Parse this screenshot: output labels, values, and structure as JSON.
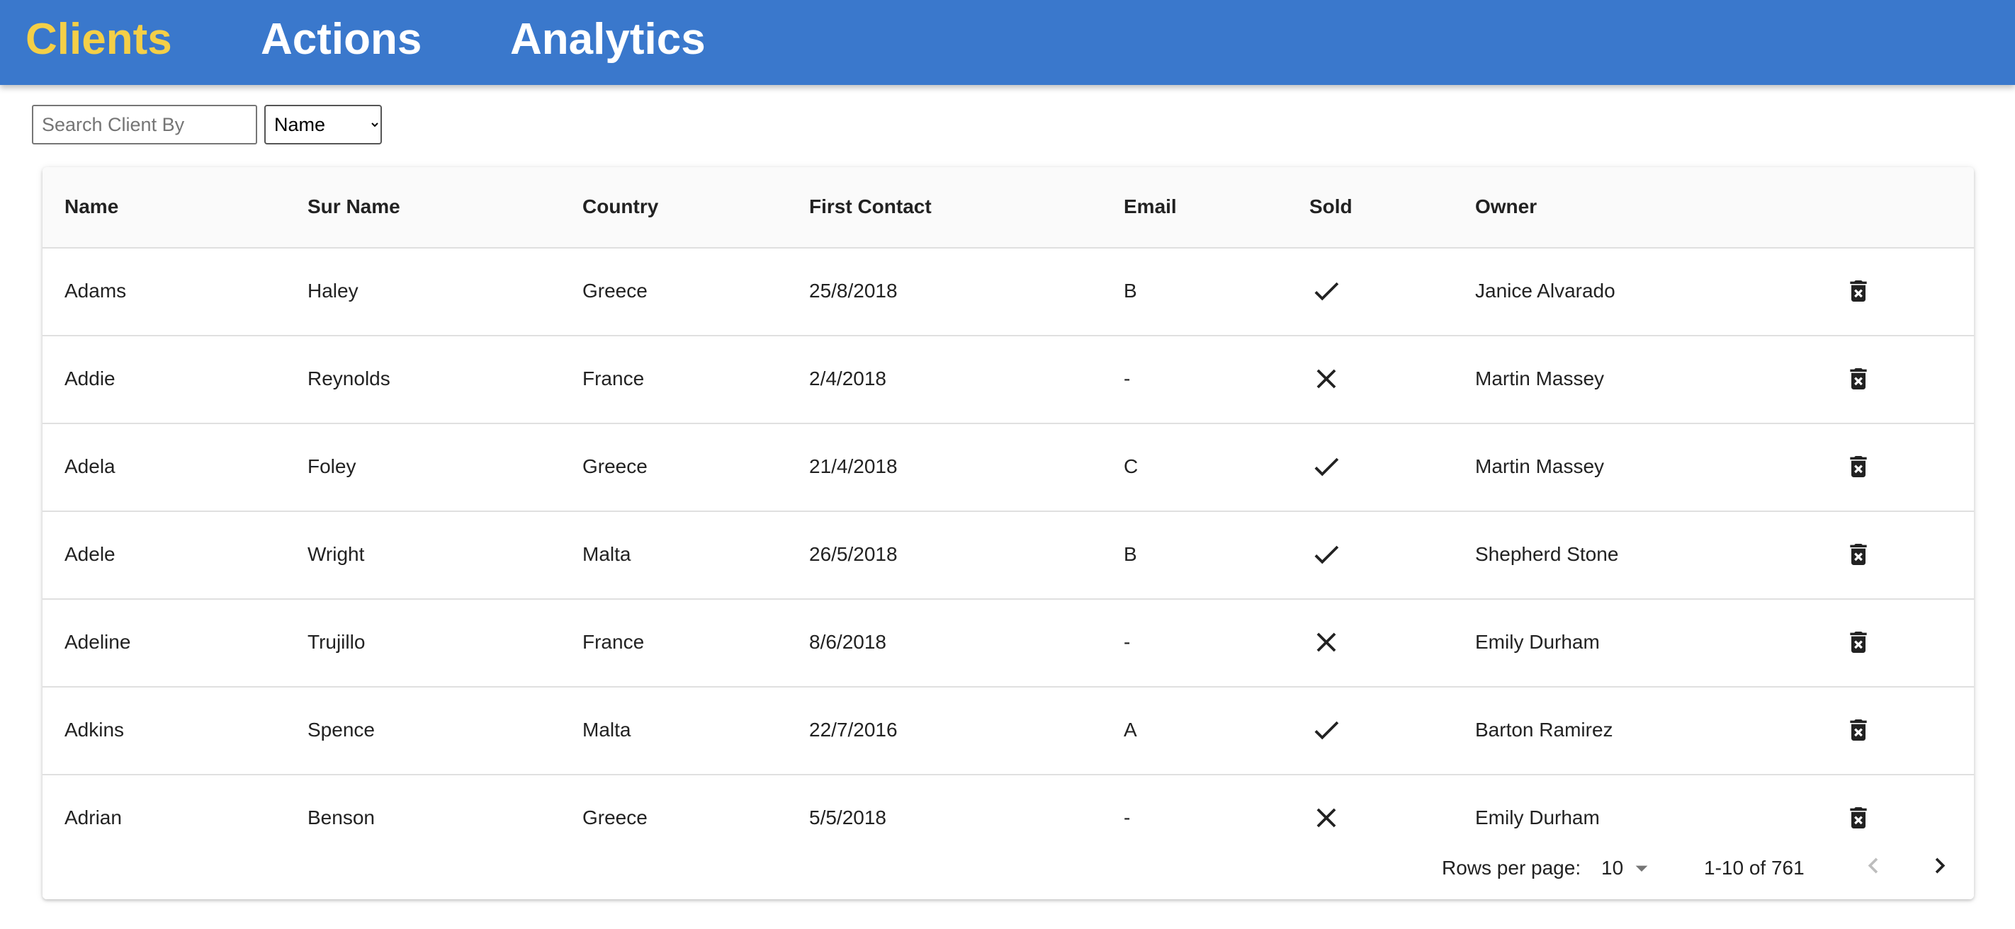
{
  "nav": {
    "items": [
      {
        "label": "Clients",
        "active": true
      },
      {
        "label": "Actions",
        "active": false
      },
      {
        "label": "Analytics",
        "active": false
      }
    ]
  },
  "search": {
    "placeholder": "Search Client By",
    "value": "",
    "field_selected": "Name",
    "field_options": [
      "Name"
    ]
  },
  "table": {
    "columns": [
      "Name",
      "Sur Name",
      "Country",
      "First Contact",
      "Email",
      "Sold",
      "Owner"
    ],
    "rows": [
      {
        "name": "Adams",
        "surname": "Haley",
        "country": "Greece",
        "first_contact": "25/8/2018",
        "email": "B",
        "sold": true,
        "owner": "Janice Alvarado"
      },
      {
        "name": "Addie",
        "surname": "Reynolds",
        "country": "France",
        "first_contact": "2/4/2018",
        "email": "-",
        "sold": false,
        "owner": "Martin Massey"
      },
      {
        "name": "Adela",
        "surname": "Foley",
        "country": "Greece",
        "first_contact": "21/4/2018",
        "email": "C",
        "sold": true,
        "owner": "Martin Massey"
      },
      {
        "name": "Adele",
        "surname": "Wright",
        "country": "Malta",
        "first_contact": "26/5/2018",
        "email": "B",
        "sold": true,
        "owner": "Shepherd Stone"
      },
      {
        "name": "Adeline",
        "surname": "Trujillo",
        "country": "France",
        "first_contact": "8/6/2018",
        "email": "-",
        "sold": false,
        "owner": "Emily Durham"
      },
      {
        "name": "Adkins",
        "surname": "Spence",
        "country": "Malta",
        "first_contact": "22/7/2016",
        "email": "A",
        "sold": true,
        "owner": "Barton Ramirez"
      },
      {
        "name": "Adrian",
        "surname": "Benson",
        "country": "Greece",
        "first_contact": "5/5/2018",
        "email": "-",
        "sold": false,
        "owner": "Emily Durham"
      }
    ]
  },
  "pagination": {
    "rows_per_page_label": "Rows per page:",
    "rows_per_page": "10",
    "range_label": "1-10 of 761"
  },
  "icons": {
    "sold_true": "check-icon",
    "sold_false": "close-icon",
    "delete": "delete-forever-icon",
    "rows_dropdown": "arrow-drop-down-icon",
    "prev": "chevron-left-icon",
    "next": "chevron-right-icon"
  },
  "colors": {
    "nav_bg": "#3a78cc",
    "nav_active": "#f4cf47",
    "nav_text": "#ffffff"
  }
}
